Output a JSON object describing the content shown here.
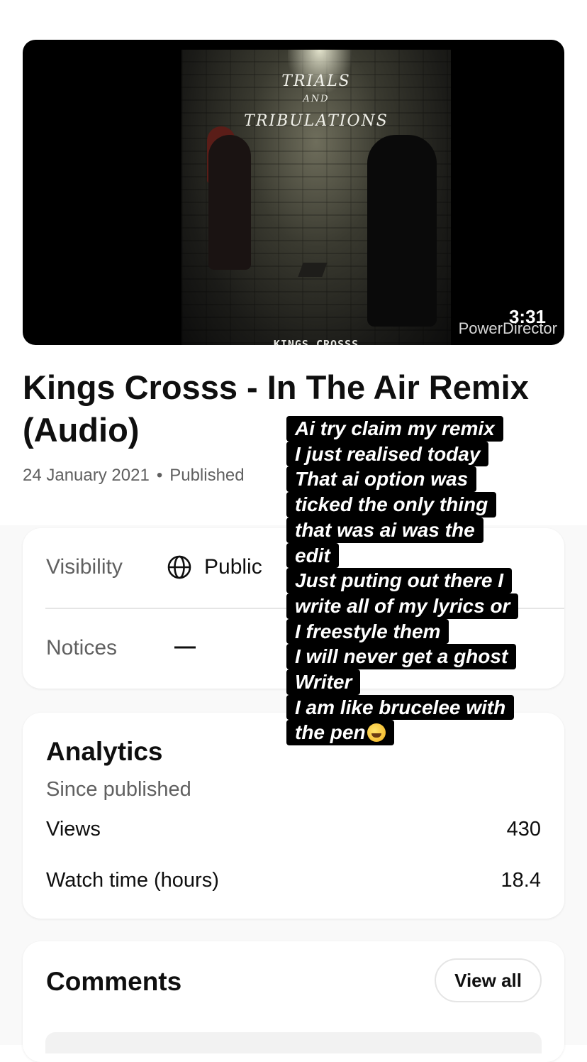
{
  "video": {
    "artwork": {
      "title_line1": "TRIALS",
      "title_line2": "AND",
      "title_line3": "TRIBULATIONS",
      "artist": "KINGS CROSSS"
    },
    "watermark": "PowerDirector",
    "duration": "3:31"
  },
  "title": "Kings Crosss - In The Air Remix (Audio)",
  "meta": {
    "date": "24 January 2021",
    "status": "Published"
  },
  "details": {
    "visibility_label": "Visibility",
    "visibility_value": "Public",
    "notices_label": "Notices",
    "notices_value": "—"
  },
  "analytics": {
    "title": "Analytics",
    "subtitle": "Since published",
    "rows": [
      {
        "label": "Views",
        "value": "430"
      },
      {
        "label": "Watch time (hours)",
        "value": "18.4"
      }
    ]
  },
  "comments": {
    "title": "Comments",
    "view_all": "View all"
  },
  "overlay": {
    "lines": [
      "Ai try claim  my remix",
      "I just realised today",
      "That ai option was",
      "ticked the only thing",
      "that was ai was the",
      "edit",
      "Just puting out there I",
      "write all of my lyrics or",
      "I freestyle them",
      "I will never get a ghost",
      "Writer",
      "I am like brucelee with",
      "the pen"
    ],
    "emoji": "rolling-on-floor-laughing"
  }
}
